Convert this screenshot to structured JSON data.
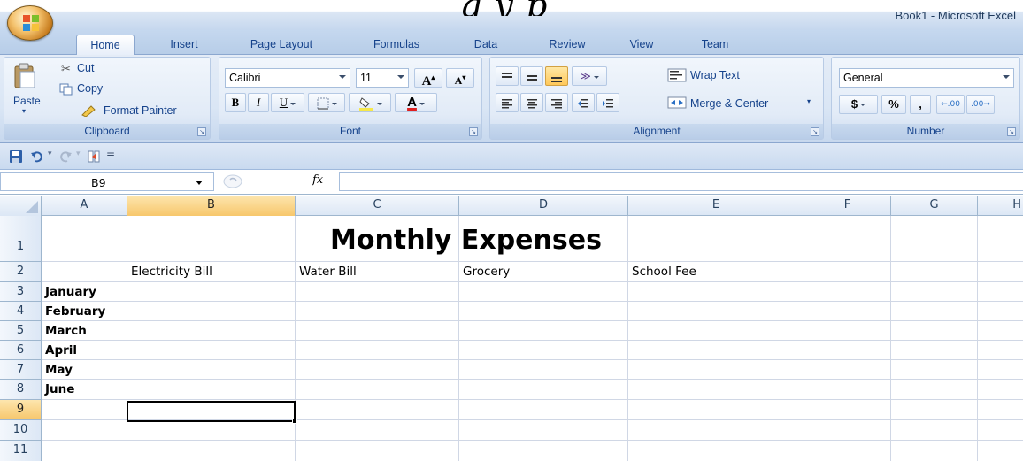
{
  "window": {
    "title": "Book1 - Microsoft Excel",
    "overlay_text": "g   y   p"
  },
  "tabs": [
    {
      "label": "Home",
      "active": true
    },
    {
      "label": "Insert"
    },
    {
      "label": "Page Layout"
    },
    {
      "label": "Formulas"
    },
    {
      "label": "Data"
    },
    {
      "label": "Review"
    },
    {
      "label": "View"
    },
    {
      "label": "Team"
    }
  ],
  "ribbon": {
    "clipboard": {
      "label": "Clipboard",
      "paste": "Paste",
      "cut": "Cut",
      "copy": "Copy",
      "format_painter": "Format Painter"
    },
    "font": {
      "label": "Font",
      "font_name": "Calibri",
      "font_size": "11",
      "bold": "B",
      "italic": "I",
      "underline": "U",
      "grow": "A",
      "shrink": "A",
      "font_color_letter": "A",
      "font_color": "#e02020",
      "fill_color": "#f6e84a"
    },
    "alignment": {
      "label": "Alignment",
      "wrap_text": "Wrap Text",
      "merge_center": "Merge & Center"
    },
    "number": {
      "label": "Number",
      "format": "General",
      "currency": "$",
      "percent": "%",
      "comma": ","
    }
  },
  "formula_bar": {
    "name_box": "B9",
    "fx_label": "fx",
    "value": ""
  },
  "sheet": {
    "columns": [
      "A",
      "B",
      "C",
      "D",
      "E",
      "F",
      "G",
      "H"
    ],
    "selected_column": "B",
    "rows": [
      "1",
      "2",
      "3",
      "4",
      "5",
      "6",
      "7",
      "8",
      "9",
      "10",
      "11"
    ],
    "selected_row": "9",
    "title": "Monthly Expenses",
    "headers": [
      "Electricity Bill",
      "Water Bill",
      "Grocery",
      "School Fee"
    ],
    "months": [
      "January",
      "February",
      "March",
      "April",
      "May",
      "June"
    ],
    "active_cell": "B9"
  },
  "colors": {
    "ribbon_blue": "#dae6f5",
    "text_blue": "#15428b",
    "selection_orange": "#f7c76c"
  }
}
